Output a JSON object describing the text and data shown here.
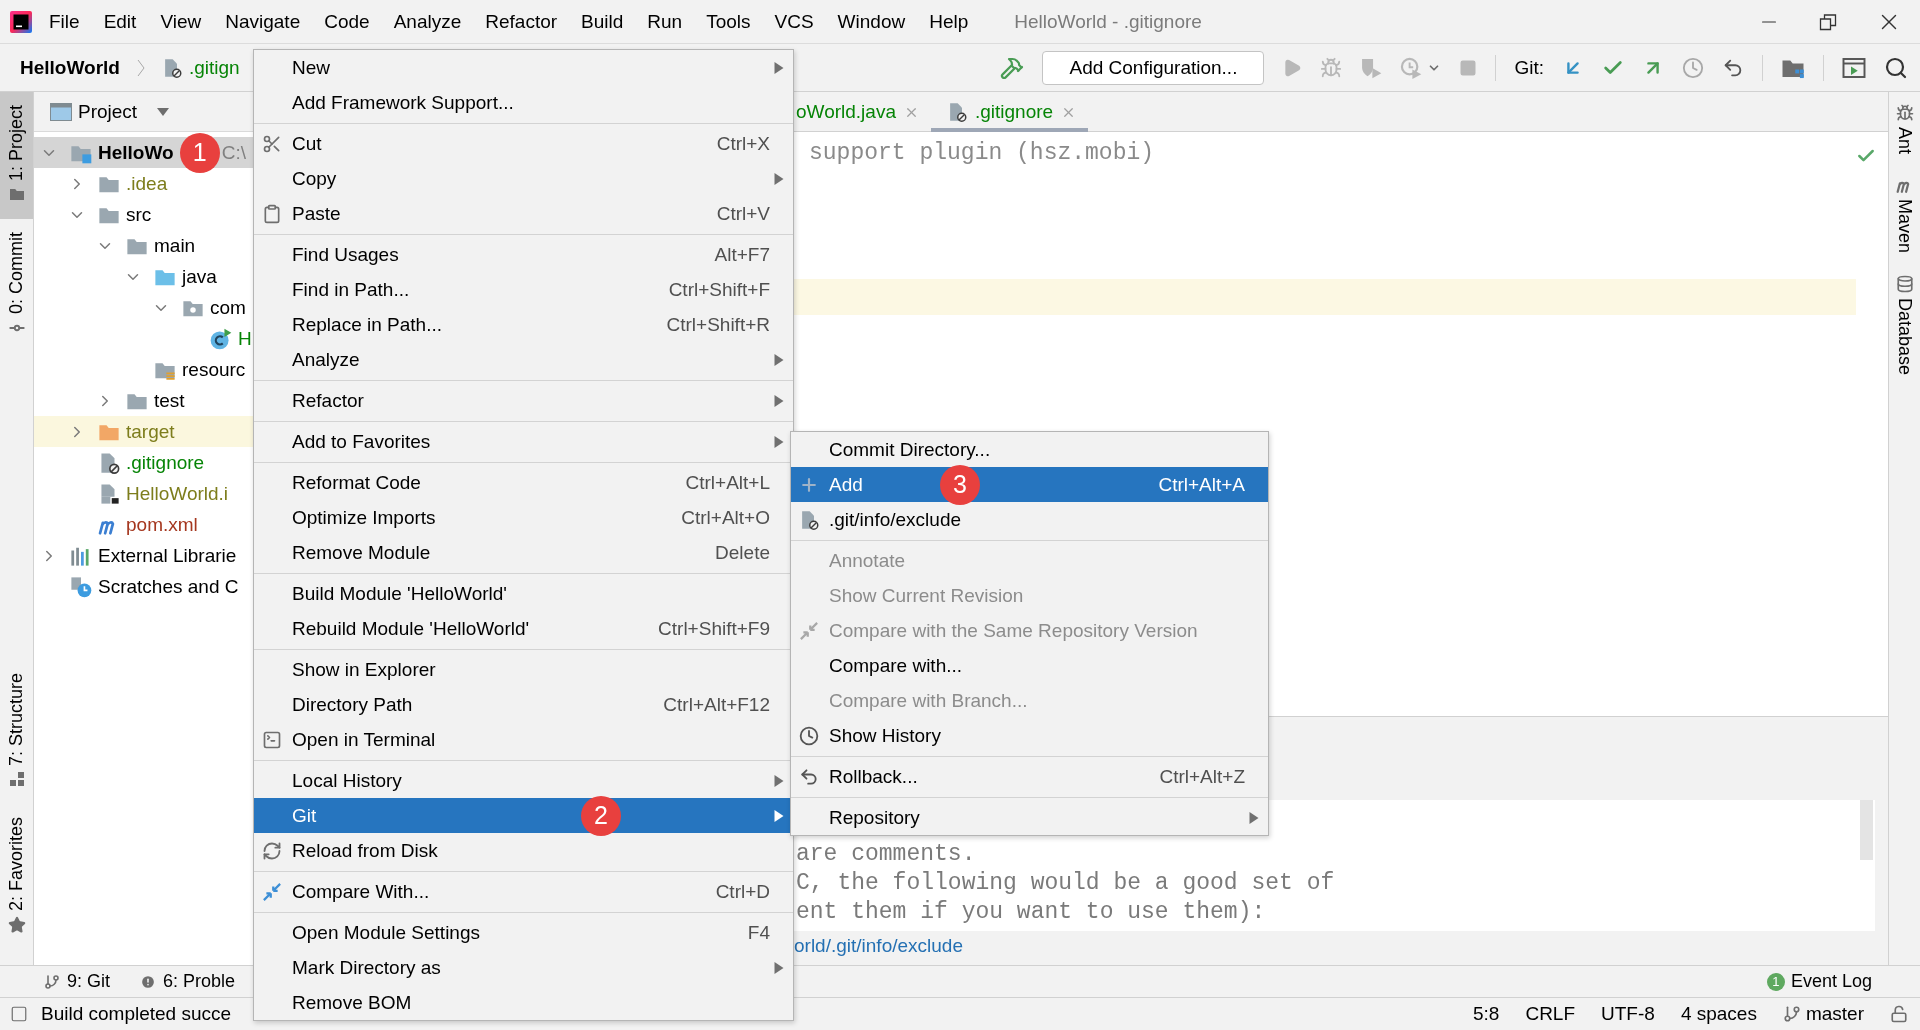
{
  "window": {
    "title": "HelloWorld - .gitignore"
  },
  "menu_bar": [
    "File",
    "Edit",
    "View",
    "Navigate",
    "Code",
    "Analyze",
    "Refactor",
    "Build",
    "Run",
    "Tools",
    "VCS",
    "Window",
    "Help"
  ],
  "navigation_bar": {
    "breadcrumbs": [
      {
        "label": "HelloWorld",
        "kind": "module",
        "color": "#000000"
      },
      {
        "label": ".gitign",
        "kind": "ignore-file",
        "color": "#068406"
      }
    ]
  },
  "toolbar": {
    "configuration_button": "Add Configuration...",
    "run_actions_disabled": true,
    "git_label": "Git:"
  },
  "left_tool_strip": {
    "top": [
      {
        "label": "1: Project",
        "selected": true
      },
      {
        "label": "0: Commit",
        "selected": false
      }
    ],
    "bottom": [
      {
        "label": "7: Structure",
        "selected": false
      },
      {
        "label": "2: Favorites",
        "selected": false
      }
    ]
  },
  "project_panel": {
    "title": "Project",
    "tree": [
      {
        "label": "HelloWo",
        "kind": "module",
        "badge": "1",
        "path": "C:\\",
        "color": "#000000",
        "expanded": true,
        "selected": true,
        "highlighted": false,
        "children": [
          {
            "label": ".idea",
            "kind": "folder",
            "color": "#7d7d1c",
            "expanded": false,
            "selected": false,
            "highlighted": false
          },
          {
            "label": "src",
            "kind": "folder",
            "color": "#000000",
            "expanded": true,
            "selected": false,
            "highlighted": false,
            "children": [
              {
                "label": "main",
                "kind": "folder",
                "color": "#000000",
                "expanded": true,
                "selected": false,
                "highlighted": false,
                "children": [
                  {
                    "label": "java",
                    "kind": "source-folder",
                    "color": "#000000",
                    "expanded": true,
                    "selected": false,
                    "highlighted": false,
                    "children": [
                      {
                        "label": "com",
                        "kind": "package",
                        "color": "#000000",
                        "expanded": true,
                        "selected": false,
                        "highlighted": false,
                        "children": [
                          {
                            "label": "H",
                            "kind": "class",
                            "color": "#068406",
                            "selected": false,
                            "highlighted": false
                          }
                        ]
                      }
                    ]
                  },
                  {
                    "label": "resourc",
                    "kind": "resources-folder",
                    "color": "#000000",
                    "selected": false,
                    "highlighted": false
                  }
                ]
              },
              {
                "label": "test",
                "kind": "folder",
                "color": "#000000",
                "expanded": false,
                "selected": false,
                "highlighted": false
              }
            ]
          },
          {
            "label": "target",
            "kind": "excluded-folder",
            "color": "#7d7d1c",
            "expanded": false,
            "selected": false,
            "highlighted": true
          },
          {
            "label": ".gitignore",
            "kind": "ignore-file",
            "color": "#068406",
            "selected": false,
            "highlighted": false
          },
          {
            "label": "HelloWorld.i",
            "kind": "module-file",
            "color": "#7d7d1c",
            "selected": false,
            "highlighted": false
          },
          {
            "label": "pom.xml",
            "kind": "maven-file",
            "color": "#a5371f",
            "selected": false,
            "highlighted": false
          }
        ]
      },
      {
        "label": "External Librarie",
        "kind": "libraries",
        "color": "#000000",
        "expanded": false,
        "selected": false,
        "highlighted": false
      },
      {
        "label": "Scratches and C",
        "kind": "scratches",
        "color": "#000000",
        "selected": false,
        "highlighted": false
      }
    ]
  },
  "editor": {
    "tabs": [
      {
        "label": "oWorld.java",
        "color": "#068406",
        "selected": false
      },
      {
        "label": ".gitignore",
        "kind": "ignore-file",
        "color": "#068406",
        "selected": true
      }
    ],
    "lines": [
      "support plugin (hsz.mobi)"
    ],
    "current_line_highlighted": true,
    "preview": {
      "lines": [
        "are comments.",
        "C, the following would be a good set of",
        "ent them if you want to use them):"
      ],
      "link": "orld/.git/info/exclude"
    }
  },
  "right_tool_strip": [
    {
      "label": "Ant",
      "selected": false
    },
    {
      "label": "Maven",
      "selected": false
    },
    {
      "label": "Database",
      "selected": false
    }
  ],
  "bottom_tool_bar": {
    "tabs": [
      {
        "label": "9: Git",
        "selected": false
      },
      {
        "label": "6: Proble",
        "selected": false
      }
    ],
    "event_log": {
      "label": "Event Log",
      "count": "1"
    }
  },
  "status_bar": {
    "message": "Build completed succe",
    "caret_position": "5:8",
    "line_separator": "CRLF",
    "encoding": "UTF-8",
    "indent": "4 spaces",
    "branch": "master"
  },
  "context_menu": {
    "groups": [
      [
        {
          "label": "New",
          "submenu": true,
          "selected": false
        },
        {
          "label": "Add Framework Support...",
          "submenu": false,
          "selected": false
        }
      ],
      [
        {
          "label": "Cut",
          "shortcut": "Ctrl+X",
          "submenu": false,
          "selected": false
        },
        {
          "label": "Copy",
          "submenu": true,
          "selected": false
        },
        {
          "label": "Paste",
          "shortcut": "Ctrl+V",
          "submenu": false,
          "selected": false
        }
      ],
      [
        {
          "label": "Find Usages",
          "shortcut": "Alt+F7",
          "submenu": false,
          "selected": false
        },
        {
          "label": "Find in Path...",
          "shortcut": "Ctrl+Shift+F",
          "submenu": false,
          "selected": false
        },
        {
          "label": "Replace in Path...",
          "shortcut": "Ctrl+Shift+R",
          "submenu": false,
          "selected": false
        },
        {
          "label": "Analyze",
          "submenu": true,
          "selected": false
        }
      ],
      [
        {
          "label": "Refactor",
          "submenu": true,
          "selected": false
        }
      ],
      [
        {
          "label": "Add to Favorites",
          "submenu": true,
          "selected": false
        }
      ],
      [
        {
          "label": "Reformat Code",
          "shortcut": "Ctrl+Alt+L",
          "submenu": false,
          "selected": false
        },
        {
          "label": "Optimize Imports",
          "shortcut": "Ctrl+Alt+O",
          "submenu": false,
          "selected": false
        },
        {
          "label": "Remove Module",
          "shortcut": "Delete",
          "submenu": false,
          "selected": false
        }
      ],
      [
        {
          "label": "Build Module 'HelloWorld'",
          "submenu": false,
          "selected": false
        },
        {
          "label": "Rebuild Module 'HelloWorld'",
          "shortcut": "Ctrl+Shift+F9",
          "submenu": false,
          "selected": false
        }
      ],
      [
        {
          "label": "Show in Explorer",
          "submenu": false,
          "selected": false
        },
        {
          "label": "Directory Path",
          "shortcut": "Ctrl+Alt+F12",
          "submenu": false,
          "selected": false
        },
        {
          "label": "Open in Terminal",
          "submenu": false,
          "selected": false
        }
      ],
      [
        {
          "label": "Local History",
          "submenu": true,
          "selected": false
        },
        {
          "label": "Git",
          "submenu": true,
          "selected": true,
          "badge": "2"
        },
        {
          "label": "Reload from Disk",
          "submenu": false,
          "selected": false
        }
      ],
      [
        {
          "label": "Compare With...",
          "shortcut": "Ctrl+D",
          "submenu": false,
          "selected": false
        }
      ],
      [
        {
          "label": "Open Module Settings",
          "shortcut": "F4",
          "submenu": false,
          "selected": false
        },
        {
          "label": "Mark Directory as",
          "submenu": true,
          "selected": false
        },
        {
          "label": "Remove BOM",
          "submenu": false,
          "selected": false
        }
      ]
    ]
  },
  "git_submenu": {
    "groups": [
      [
        {
          "label": "Commit Directory...",
          "submenu": false,
          "selected": false,
          "disabled": false
        },
        {
          "label": "Add",
          "shortcut": "Ctrl+Alt+A",
          "badge": "3",
          "submenu": false,
          "selected": true,
          "disabled": false
        },
        {
          "label": ".git/info/exclude",
          "submenu": false,
          "selected": false,
          "disabled": false
        }
      ],
      [
        {
          "label": "Annotate",
          "submenu": false,
          "selected": false,
          "disabled": true
        },
        {
          "label": "Show Current Revision",
          "submenu": false,
          "selected": false,
          "disabled": true
        },
        {
          "label": "Compare with the Same Repository Version",
          "submenu": false,
          "selected": false,
          "disabled": true
        },
        {
          "label": "Compare with...",
          "submenu": false,
          "selected": false,
          "disabled": false
        },
        {
          "label": "Compare with Branch...",
          "submenu": false,
          "selected": false,
          "disabled": true
        },
        {
          "label": "Show History",
          "submenu": false,
          "selected": false,
          "disabled": false
        }
      ],
      [
        {
          "label": "Rollback...",
          "shortcut": "Ctrl+Alt+Z",
          "submenu": false,
          "selected": false,
          "disabled": false
        }
      ],
      [
        {
          "label": "Repository",
          "submenu": true,
          "selected": false,
          "disabled": false
        }
      ]
    ]
  }
}
